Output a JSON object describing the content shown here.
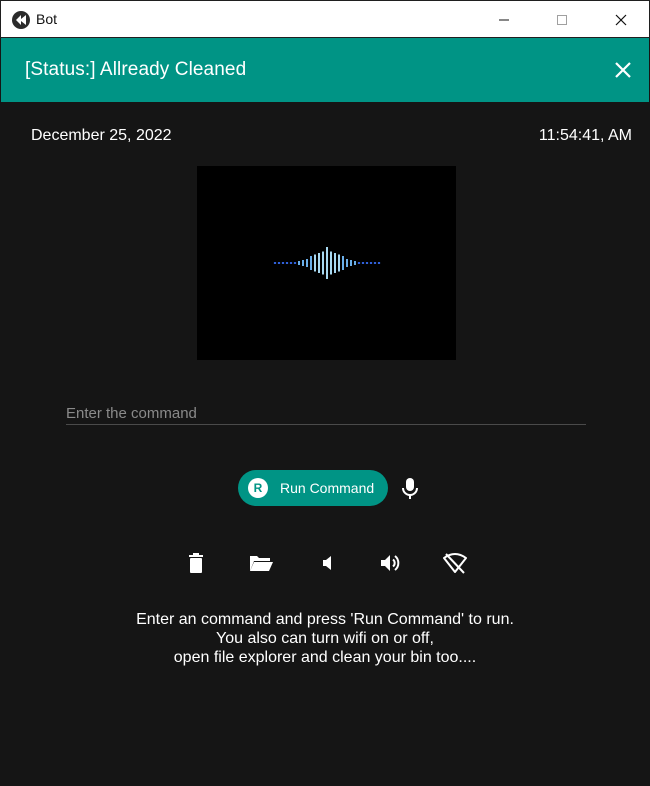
{
  "window": {
    "title": "Bot",
    "icon": "kivy-logo-icon",
    "controls": [
      "minimize-icon",
      "maximize-icon",
      "close-icon"
    ]
  },
  "appbar": {
    "title": "[Status:] Allready Cleaned",
    "close_icon": "close-icon",
    "color": "#009485"
  },
  "date": "December 25, 2022",
  "time": "11:54:41, AM",
  "visualizer": {
    "icon": "audio-waveform"
  },
  "command": {
    "placeholder": "Enter the command",
    "value": ""
  },
  "run_button": {
    "badge": "R",
    "label": "Run Command"
  },
  "mic_icon": "microphone-icon",
  "tools": [
    {
      "name": "delete-icon"
    },
    {
      "name": "folder-open-icon"
    },
    {
      "name": "volume-down-icon"
    },
    {
      "name": "volume-up-icon"
    },
    {
      "name": "wifi-off-icon"
    }
  ],
  "help": {
    "line1": "Enter an command and press 'Run Command' to run.",
    "line2": "You also can turn wifi on or off,",
    "line3": "open file explorer and clean your bin too...."
  },
  "colors": {
    "background": "#151515",
    "accent": "#009485",
    "text": "#ffffff"
  }
}
